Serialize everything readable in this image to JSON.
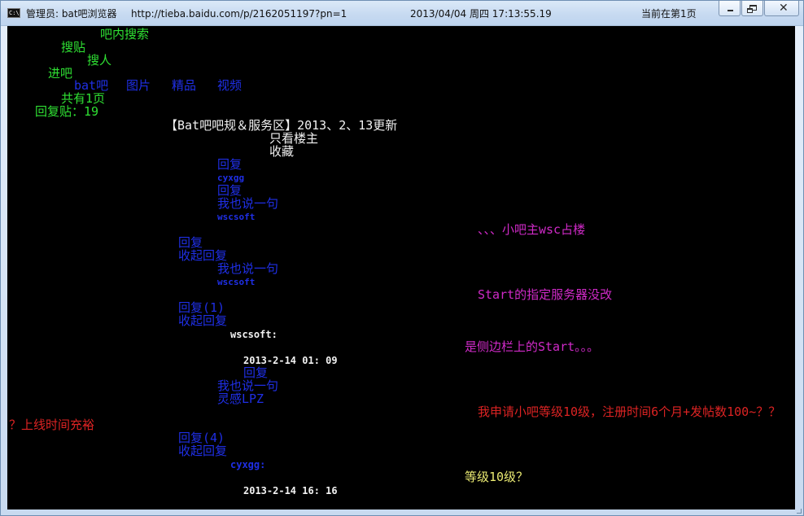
{
  "window": {
    "admin_label": "管理员: bat吧浏览器",
    "url": "http://tieba.baidu.com/p/2162051197?pn=1",
    "datetime": "2013/04/04 周四 17:13:55.19",
    "page_status": "当前在第1页",
    "icon_label": "C:\\"
  },
  "console": {
    "search_bar": "吧内搜索",
    "search_posts": "搜贴",
    "search_people": "搜人",
    "enter_bar": "进吧",
    "nav": {
      "bat": "bat吧",
      "pictures": "图片",
      "featured": "精品",
      "video": "视频"
    },
    "total_pages": "共有1页",
    "reply_count": "回复贴：19",
    "post_title": "【Bat吧吧规＆服务区】2013、2、13更新",
    "owner_only": "只看楼主",
    "favorite": "收藏",
    "reply_1": "回复",
    "user_cyxgg_1": "cyxgg",
    "reply_2": "回复",
    "say_1": "我也说一句",
    "user_wscsoft_1": "wscsoft",
    "floor_1_text": "、、、小吧主wsc占楼",
    "reply_3": "回复",
    "collapse_1": "收起回复",
    "say_2": "我也说一句",
    "user_wscsoft_2": "wscsoft",
    "start_text": "Start的指定服务器没改",
    "reply_with_count_1": "回复(1)",
    "collapse_2": "收起回复",
    "wscsoft_colon": "wscsoft:",
    "sidebar_start": "是侧边栏上的Start。。。",
    "date_1": "2013-2-14 01: 09",
    "reply_4": "回复",
    "say_3": "我也说一句",
    "user_lingan": "灵感LPZ",
    "request_text": "我申请小吧等级10级，注册时间6个月+发帖数100~？？",
    "online_time": "？上线时间充裕",
    "reply_with_count_4": "回复(4)",
    "collapse_3": "收起回复",
    "cyxgg_colon": "cyxgg:",
    "level_question": "等级10级？",
    "date_2": "2013-2-14 16: 16"
  },
  "colors": {
    "green": "#2fe033",
    "blue": "#1f2fe6",
    "white": "#f2f2f2",
    "magenta": "#d02ac8",
    "red": "#dc2323",
    "yellow": "#eaea72"
  }
}
